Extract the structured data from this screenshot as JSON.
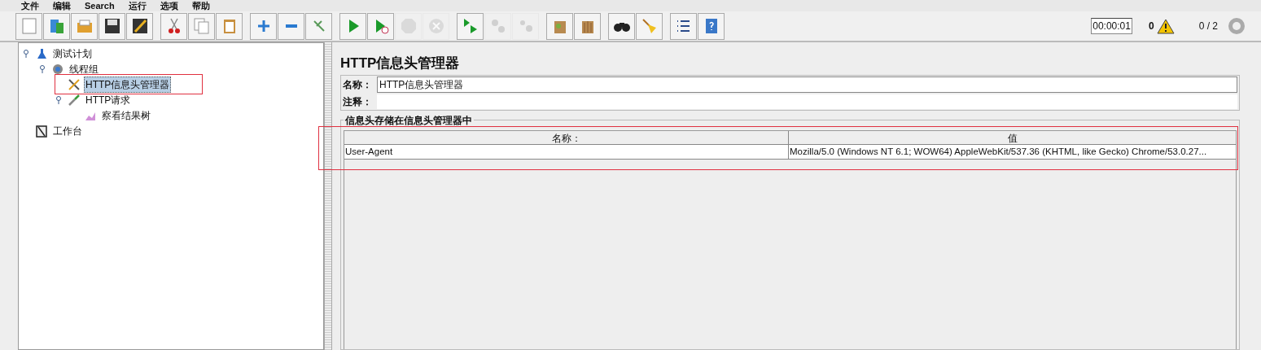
{
  "menu": [
    "文件",
    "编辑",
    "Search",
    "运行",
    "选项",
    "帮助"
  ],
  "toolbar_groups": [
    [
      {
        "kind": "new",
        "disabled": false
      },
      {
        "kind": "templates",
        "disabled": false
      },
      {
        "kind": "open",
        "disabled": false
      },
      {
        "kind": "save",
        "disabled": false
      },
      {
        "kind": "save-as",
        "disabled": false
      }
    ],
    [
      {
        "kind": "cut",
        "disabled": false
      },
      {
        "kind": "copy",
        "disabled": false
      },
      {
        "kind": "paste",
        "disabled": false
      }
    ],
    [
      {
        "kind": "expand",
        "disabled": false
      },
      {
        "kind": "collapse",
        "disabled": false
      },
      {
        "kind": "toggle",
        "disabled": false
      }
    ],
    [
      {
        "kind": "start",
        "disabled": false
      },
      {
        "kind": "start-no-pause",
        "disabled": false
      },
      {
        "kind": "stop",
        "disabled": true
      },
      {
        "kind": "shutdown",
        "disabled": true
      }
    ],
    [
      {
        "kind": "remote-start",
        "disabled": false
      },
      {
        "kind": "remote-stop",
        "disabled": true
      },
      {
        "kind": "remote-exit",
        "disabled": true
      }
    ],
    [
      {
        "kind": "clear",
        "disabled": false
      },
      {
        "kind": "clear-all",
        "disabled": false
      }
    ],
    [
      {
        "kind": "search",
        "disabled": false
      },
      {
        "kind": "reset-search",
        "disabled": false
      }
    ],
    [
      {
        "kind": "functions",
        "disabled": false
      },
      {
        "kind": "help",
        "disabled": false
      }
    ]
  ],
  "status": {
    "timer": "00:00:01",
    "warnings": "0",
    "threads": "0 / 2"
  },
  "tree": [
    {
      "label": "测试计划",
      "kind": "plan",
      "selected": false,
      "annotated": false,
      "children": [
        {
          "label": "线程组",
          "kind": "threads",
          "selected": false,
          "annotated": false,
          "children": [
            {
              "label": "HTTP信息头管理器",
              "kind": "config",
              "selected": true,
              "annotated": true
            },
            {
              "label": "HTTP请求",
              "kind": "sampler",
              "selected": false,
              "annotated": false,
              "children": [
                {
                  "label": "察看结果树",
                  "kind": "listener",
                  "selected": false,
                  "annotated": false
                }
              ]
            }
          ]
        }
      ]
    },
    {
      "label": "工作台",
      "kind": "workbench",
      "selected": false,
      "annotated": false
    }
  ],
  "panel": {
    "title": "HTTP信息头管理器",
    "name_label": "名称：",
    "name_value": "HTTP信息头管理器",
    "comment_label": "注释：",
    "group_title": "信息头存储在信息头管理器中",
    "table": {
      "annotated": true,
      "columns": [
        "名称：",
        "值"
      ],
      "rows": [
        [
          "User-Agent",
          "Mozilla/5.0 (Windows NT 6.1; WOW64) AppleWebKit/537.36 (KHTML, like Gecko) Chrome/53.0.27..."
        ]
      ]
    }
  }
}
